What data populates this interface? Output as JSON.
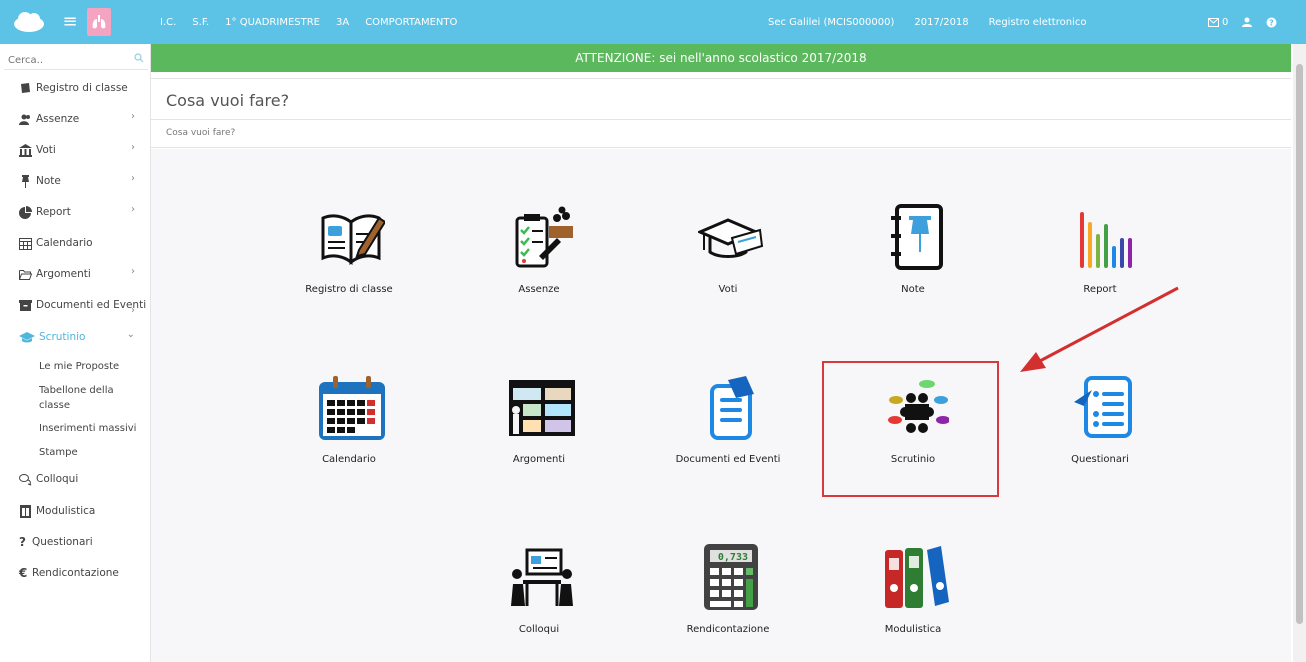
{
  "topbar": {
    "items_left": [
      "I.C.",
      "S.F.",
      "1° QUADRIMESTRE",
      "3A",
      "COMPORTAMENTO"
    ],
    "school": "Sec Galilei (MCIS000000)",
    "year": "2017/2018",
    "app": "Registro elettronico",
    "mail_count": "0"
  },
  "sidebar": {
    "search_placeholder": "Cerca..",
    "items": [
      {
        "label": "Registro di classe"
      },
      {
        "label": "Assenze"
      },
      {
        "label": "Voti"
      },
      {
        "label": "Note"
      },
      {
        "label": "Report"
      },
      {
        "label": "Calendario"
      },
      {
        "label": "Argomenti"
      },
      {
        "label": "Documenti ed Eventi"
      },
      {
        "label": "Scrutinio"
      },
      {
        "label": "Colloqui"
      },
      {
        "label": "Modulistica"
      },
      {
        "label": "Questionari"
      },
      {
        "label": "Rendicontazione"
      }
    ],
    "subitems": [
      "Le mie Proposte",
      "Tabellone della classe",
      "Inserimenti massivi",
      "Stampe"
    ]
  },
  "alert": "ATTENZIONE: sei nell'anno scolastico 2017/2018",
  "page_title": "Cosa vuoi fare?",
  "breadcrumb": "Cosa vuoi fare?",
  "tiles": [
    {
      "label": "Registro di classe"
    },
    {
      "label": "Assenze"
    },
    {
      "label": "Voti"
    },
    {
      "label": "Note"
    },
    {
      "label": "Report"
    },
    {
      "label": "Calendario"
    },
    {
      "label": "Argomenti"
    },
    {
      "label": "Documenti ed Eventi"
    },
    {
      "label": "Scrutinio"
    },
    {
      "label": "Questionari"
    },
    {
      "label": "Colloqui"
    },
    {
      "label": "Rendicontazione"
    },
    {
      "label": "Modulistica"
    }
  ],
  "calc_display": "0,733",
  "colors": {
    "topbar": "#5cc3e6",
    "alert": "#5cb85c",
    "accent": "#4fb6dc",
    "highlight": "#d73a3a"
  }
}
